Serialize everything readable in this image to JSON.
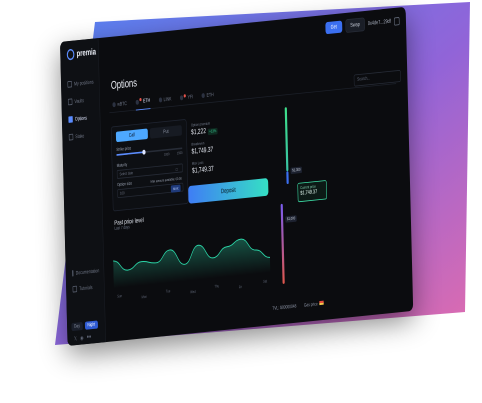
{
  "app": {
    "name": "premia",
    "page_title": "Options"
  },
  "topbar": {
    "primary_button": "Get",
    "network_button": "Swap",
    "wallet": "0x4de7...29df"
  },
  "sidebar": {
    "items": [
      {
        "label": "My positions",
        "icon": "briefcase-icon"
      },
      {
        "label": "Vaults",
        "icon": "vault-icon"
      },
      {
        "label": "Options",
        "icon": "options-icon",
        "active": true
      },
      {
        "label": "Stake",
        "icon": "stake-icon"
      }
    ],
    "bottom_items": [
      {
        "label": "Documentation",
        "icon": "book-icon"
      },
      {
        "label": "Tutorials",
        "icon": "play-icon"
      }
    ],
    "theme": {
      "light": "Day",
      "dark": "Night"
    },
    "social": [
      "twitter-icon",
      "discord-icon",
      "medium-icon"
    ]
  },
  "tabs": [
    {
      "label": "wBTC",
      "active": false
    },
    {
      "label": "ETH",
      "active": true,
      "badge": true
    },
    {
      "label": "LINK",
      "active": false
    },
    {
      "label": "YFI",
      "active": false,
      "badge": true
    },
    {
      "label": "ETH",
      "active": false
    }
  ],
  "search": {
    "placeholder": "Search..."
  },
  "form": {
    "call_label": "Call",
    "put_label": "Put",
    "strike_label": "Strike price",
    "slider_ticks": [
      "1000",
      "1500"
    ],
    "slider_fraction": 0.42,
    "maturity_label": "Maturity",
    "maturity_placeholder": "Select date",
    "amount_label": "Option size",
    "amount_hint": "Max amount available: 00.00",
    "amount_value": "100",
    "max_label": "MAX"
  },
  "stats": {
    "premium_label": "Option premium",
    "premium_value": "$1,222",
    "premium_change": "+13%",
    "breakeven_label": "Breakeven",
    "breakeven_value": "$1,749.37",
    "max_label": "Max Loss",
    "max_value": "$1,749.37"
  },
  "deposit_label": "Deposit",
  "price_level": {
    "title": "Past price level",
    "subtitle": "Last 7 days"
  },
  "chart_data": {
    "type": "area",
    "x": [
      "Sun",
      "Mon",
      "Tue",
      "Wed",
      "Thu",
      "Fri",
      "Sat"
    ],
    "values": [
      52,
      40,
      48,
      45,
      58,
      40,
      60,
      44,
      55,
      62,
      48,
      38
    ],
    "color": "#2bd4a6"
  },
  "price_markers": {
    "upper": "$1,300",
    "current_label": "Current price",
    "current_value": "$1,749.37",
    "lower": "$1,000"
  },
  "bottombar": {
    "tvl": "TVL: $00000048",
    "gas": "Gas price"
  },
  "colors": {
    "accent": "#3b6ff0",
    "green": "#2bd4a6",
    "bg": "#0b0c0f"
  }
}
